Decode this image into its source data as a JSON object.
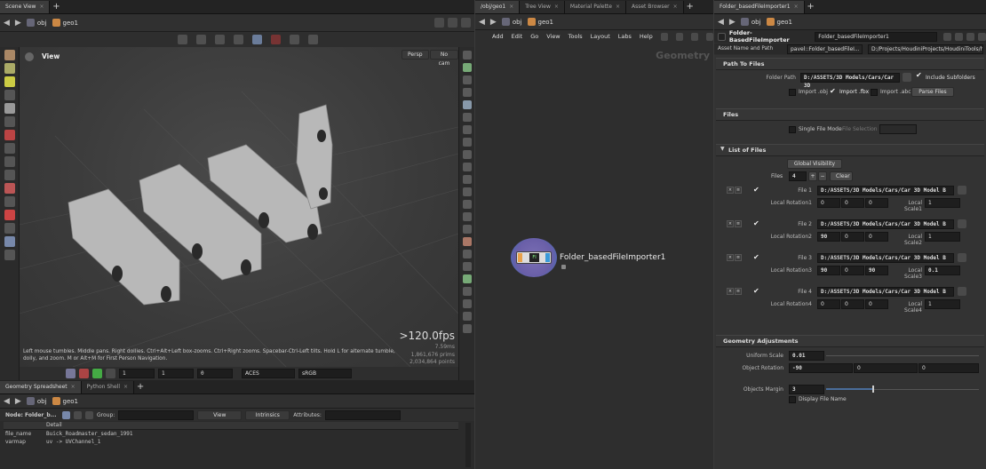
{
  "scene_view": {
    "tab": "Scene View",
    "path": "obj",
    "node": "geo1",
    "view_label": "View",
    "persp": "Persp",
    "cam": "No cam",
    "fps": ">120.0fps",
    "ms": "7.59ms",
    "stats": [
      "1,861,676 prims",
      "2,034,864 points"
    ],
    "help": "Left mouse tumbles. Middle pans. Right dollies. Ctrl+Alt+Left box-zooms. Ctrl+Right zooms. Spacebar-Ctrl-Left tilts. Hold L for alternate tumble, dolly, and zoom. M or Alt+M for First Person Navigation.",
    "bottom": {
      "val1": "1",
      "val2": "1",
      "val3": "0",
      "colorspace": "ACES",
      "display": "sRGB"
    }
  },
  "spreadsheet": {
    "tabs": [
      "Geometry Spreadsheet",
      "Python Shell"
    ],
    "path": "obj",
    "node": "geo1",
    "node_label": "Node: Folder_b...",
    "group_label": "Group:",
    "view": "View",
    "intrinsics": "Intrinsics",
    "attributes_label": "Attributes:",
    "col": "Detail",
    "rows": [
      {
        "name": "file_name",
        "value": "Buick_Roadmaster_sedan_1991"
      },
      {
        "name": "varmap",
        "value": "uv -> UVChannel_1"
      }
    ]
  },
  "network": {
    "tabs": [
      "/obj/geo1",
      "Tree View",
      "Material Palette",
      "Asset Browser"
    ],
    "path": "obj",
    "node": "geo1",
    "menu": [
      "Add",
      "Edit",
      "Go",
      "View",
      "Tools",
      "Layout",
      "Labs",
      "Help"
    ],
    "context": "Geometry",
    "node_name": "Folder_basedFileImporter1",
    "node_icon": "FI"
  },
  "params": {
    "tab": "Folder_basedFileImporter1",
    "path": "obj",
    "node": "geo1",
    "type": "Folder-BasedFileImporter",
    "name": "Folder_basedFileImporter1",
    "asset_label": "Asset Name and Path",
    "asset_name": "pavel::Folder_basedFileI...",
    "asset_path": "D:/Projects/HoudiniProjects/HoudiniTools/h...",
    "sec_path": "Path To Files",
    "folder_label": "Folder Path",
    "folder_value": "D:/ASSETS/3D Models/Cars/Car 3D",
    "include_sub": "Include Subfolders",
    "import_obj": "Import .obj",
    "import_fbx": "Import .fbx",
    "import_abc": "Import .abc",
    "parse": "Parse Files",
    "sec_files": "Files",
    "single_file": "Single File Mode",
    "file_sel": "File Selection",
    "sec_list": "List of Files",
    "global_vis": "Global Visibility",
    "files_label": "Files",
    "files_count": "4",
    "clear": "Clear",
    "rot_label": "Local Rotation",
    "scale_label": "Local Scale",
    "entries": [
      {
        "label": "File 1",
        "path": "D:/ASSETS/3D Models/Cars/Car 3D Model B",
        "rot_label": "Local Rotation1",
        "rot": [
          "0",
          "0",
          "0"
        ],
        "scale_label": "Local Scale1",
        "scale": "1"
      },
      {
        "label": "File 2",
        "path": "D:/ASSETS/3D Models/Cars/Car 3D Model B",
        "rot_label": "Local Rotation2",
        "rot": [
          "90",
          "0",
          "0"
        ],
        "scale_label": "Local Scale2",
        "scale": "1"
      },
      {
        "label": "File 3",
        "path": "D:/ASSETS/3D Models/Cars/Car 3D Model B",
        "rot_label": "Local Rotation3",
        "rot": [
          "90",
          "0",
          "90"
        ],
        "scale_label": "Local Scale3",
        "scale": "0.1"
      },
      {
        "label": "File 4",
        "path": "D:/ASSETS/3D Models/Cars/Car 3D Model B",
        "rot_label": "Local Rotation4",
        "rot": [
          "0",
          "0",
          "0"
        ],
        "scale_label": "Local Scale4",
        "scale": "1"
      }
    ],
    "sec_geo": "Geometry Adjustments",
    "uniform_label": "Uniform Scale",
    "uniform": "0.01",
    "objrot_label": "Object Rotation",
    "objrot": [
      "-90",
      "0",
      "0"
    ],
    "margin_label": "Objects Margin",
    "margin": "3",
    "display_name": "Display File Name"
  }
}
